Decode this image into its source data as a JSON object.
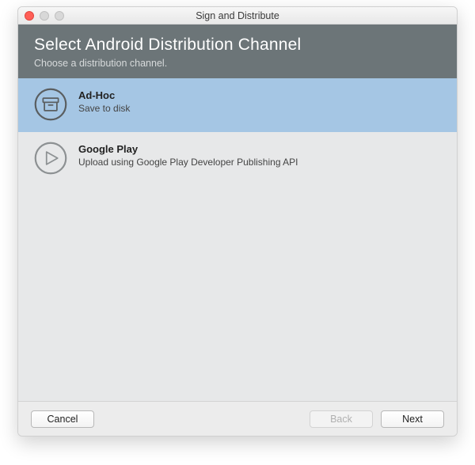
{
  "window": {
    "title": "Sign and Distribute"
  },
  "header": {
    "title": "Select Android Distribution Channel",
    "subtitle": "Choose a distribution channel."
  },
  "options": {
    "adhoc": {
      "title": "Ad-Hoc",
      "desc": "Save to disk"
    },
    "gplay": {
      "title": "Google Play",
      "desc": "Upload using Google Play Developer Publishing API"
    }
  },
  "footer": {
    "cancel": "Cancel",
    "back": "Back",
    "next": "Next"
  }
}
